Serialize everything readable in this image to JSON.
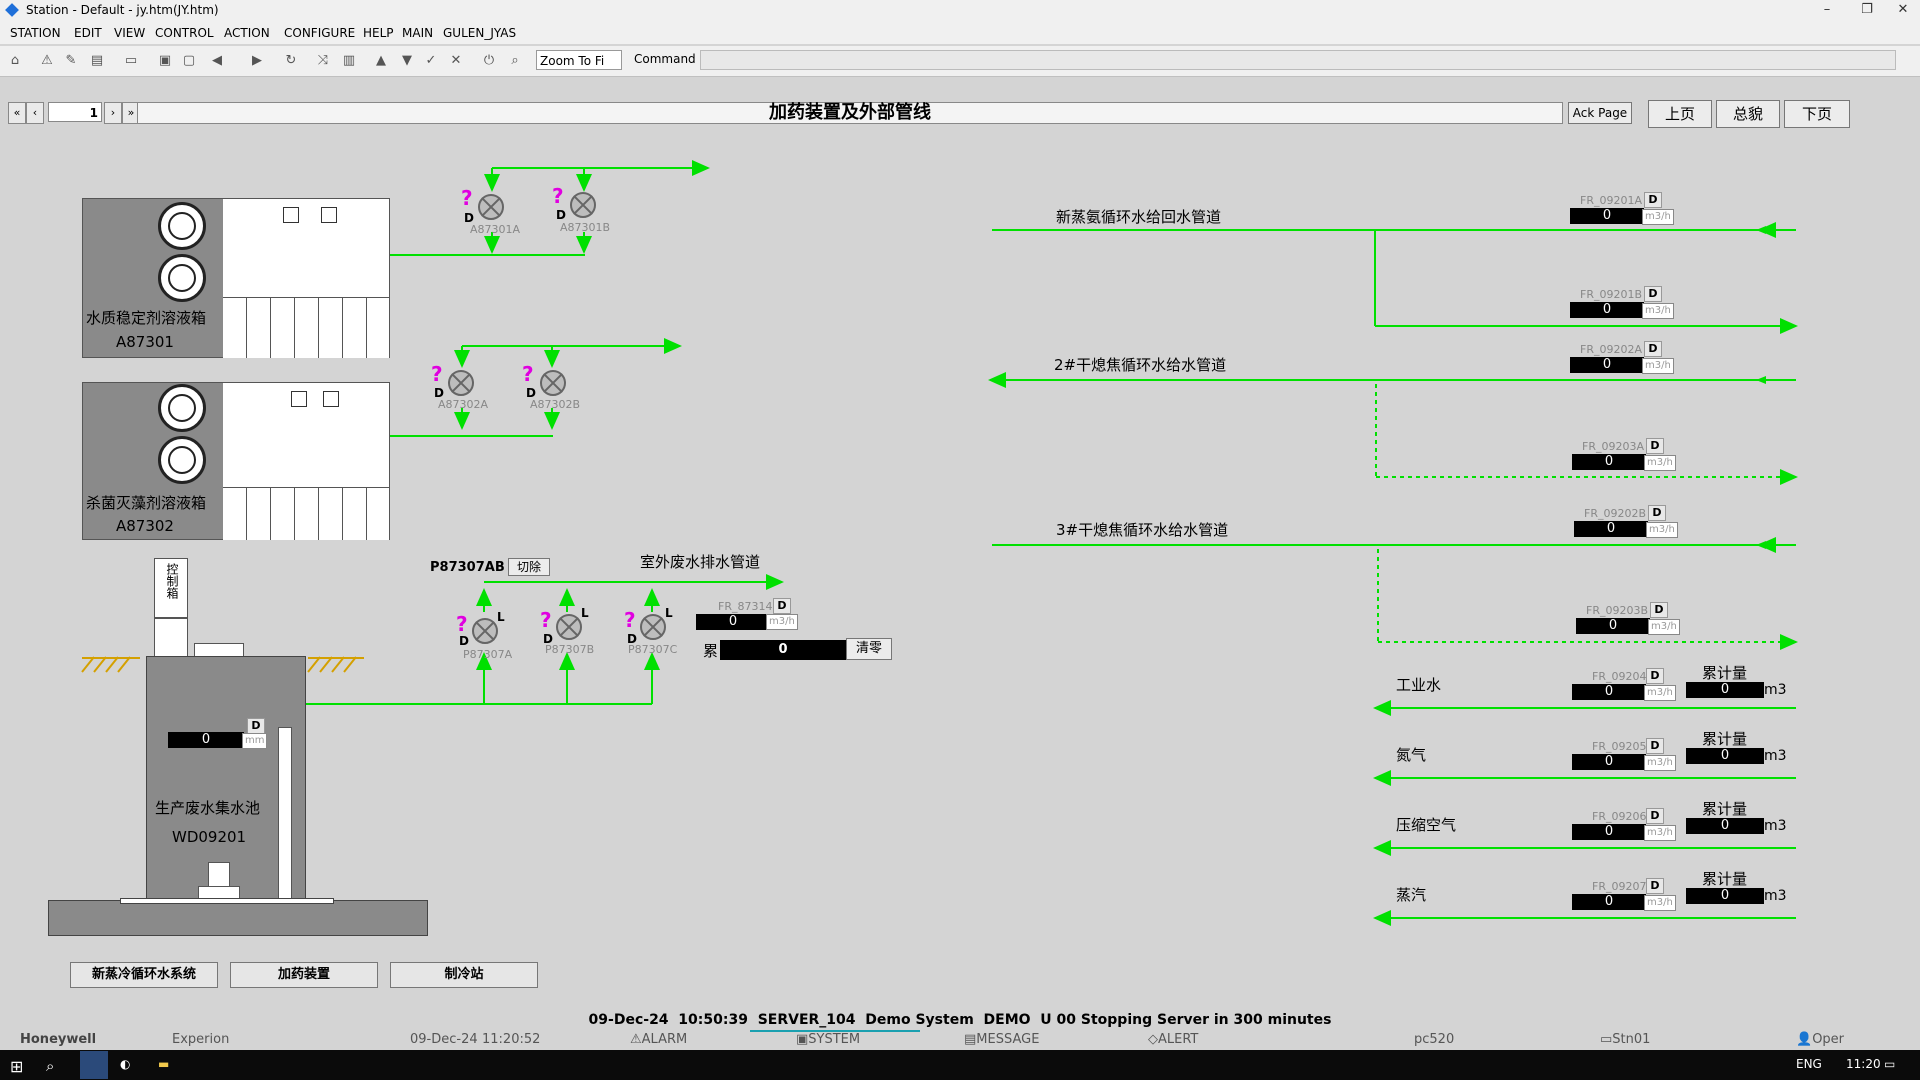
{
  "window": {
    "title": "Station - Default - jy.htm(JY.htm)"
  },
  "menu": [
    "STATION",
    "EDIT",
    "VIEW",
    "CONTROL",
    "ACTION",
    "CONFIGURE",
    "HELP",
    "MAIN",
    "GULEN_JYAS"
  ],
  "toolbar": {
    "zoom": "Zoom To Fi",
    "command_label": "Command"
  },
  "nav": {
    "page_number": "1",
    "first": "«",
    "prev": "‹",
    "next": "›",
    "last": "»"
  },
  "page": {
    "title": "加药装置及外部管线"
  },
  "buttons": {
    "ack_page": "Ack Page",
    "prev_page": "上页",
    "overview": "总貌",
    "next_page": "下页"
  },
  "tanks": [
    {
      "name": "水质稳定剂溶液箱",
      "id": "A87301"
    },
    {
      "name": "杀菌灭藻剂溶液箱",
      "id": "A87302"
    }
  ],
  "pumps": {
    "a87301a": "A87301A",
    "a87301b": "A87301B",
    "a87302a": "A87302A",
    "a87302b": "A87302B",
    "p87307a": "P87307A",
    "p87307b": "P87307B",
    "p87307c": "P87307C"
  },
  "mode_d": "D",
  "mode_l": "L",
  "question": "?",
  "control_box": "控制箱",
  "p87307ab": {
    "label": "P87307AB",
    "switch": "切除"
  },
  "outdoor_pipe": "室外废水排水管道",
  "fr87314": {
    "tag": "FR_87314",
    "value": "0",
    "unit": "m3/h"
  },
  "cumulative": {
    "label": "累",
    "value": "0",
    "reset": "清零"
  },
  "pit": {
    "value": "0",
    "unit": "mm",
    "name": "生产废水集水池",
    "id": "WD09201"
  },
  "pipelines": [
    {
      "label": "新蒸氨循环水给回水管道"
    },
    {
      "label": "2#干熄焦循环水给水管道"
    },
    {
      "label": "3#干熄焦循环水给水管道"
    }
  ],
  "flows": [
    {
      "tag": "FR_09201A",
      "value": "0",
      "unit": "m3/h"
    },
    {
      "tag": "FR_09201B",
      "value": "0",
      "unit": "m3/h"
    },
    {
      "tag": "FR_09202A",
      "value": "0",
      "unit": "m3/h"
    },
    {
      "tag": "FR_09203A",
      "value": "0",
      "unit": "m3/h"
    },
    {
      "tag": "FR_09202B",
      "value": "0",
      "unit": "m3/h"
    },
    {
      "tag": "FR_09203B",
      "value": "0",
      "unit": "m3/h"
    }
  ],
  "utilities": [
    {
      "label": "工业水",
      "tag": "FR_09204",
      "value": "0",
      "unit": "m3/h",
      "total_label": "累计量",
      "total": "0",
      "total_unit": "m3"
    },
    {
      "label": "氮气",
      "tag": "FR_09205",
      "value": "0",
      "unit": "m3/h",
      "total_label": "累计量",
      "total": "0",
      "total_unit": "m3"
    },
    {
      "label": "压缩空气",
      "tag": "FR_09206",
      "value": "0",
      "unit": "m3/h",
      "total_label": "累计量",
      "total": "0",
      "total_unit": "m3"
    },
    {
      "label": "蒸汽",
      "tag": "FR_09207",
      "value": "0",
      "unit": "m3/h",
      "total_label": "累计量",
      "total": "0",
      "total_unit": "m3"
    }
  ],
  "bottom_buttons": [
    "新蒸冷循环水系统",
    "加药装置",
    "制冷站"
  ],
  "status": {
    "text": "09-Dec-24  10:50:39  SERVER_104  Demo System  DEMO  U 00 Stopping Server in 300 minutes"
  },
  "statusbar": {
    "brand": "Honeywell",
    "product": "Experion",
    "date": "09-Dec-24",
    "time": "11:20:52",
    "alarm": "ALARM",
    "system": "SYSTEM",
    "message": "MESSAGE",
    "alert": "ALERT",
    "host": "pc520",
    "station": "Stn01",
    "user": "Oper"
  },
  "taskbar": {
    "lang": "ENG",
    "clock": "11:20"
  },
  "colors": {
    "pipe": "#00e000",
    "background": "#d4d4d4"
  }
}
